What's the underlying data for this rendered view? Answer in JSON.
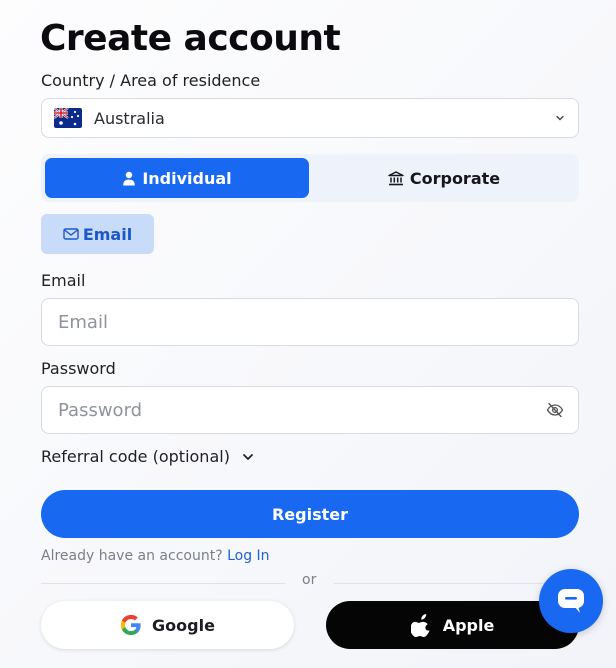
{
  "page": {
    "title": "Create account"
  },
  "country": {
    "label": "Country / Area of residence",
    "selected": "Australia",
    "flag_icon": "australia-flag-icon"
  },
  "account_type": {
    "individual": "Individual",
    "corporate": "Corporate",
    "active": "Individual"
  },
  "method_tab": {
    "label": "Email"
  },
  "email": {
    "label": "Email",
    "placeholder": "Email",
    "value": ""
  },
  "password": {
    "label": "Password",
    "placeholder": "Password",
    "value": ""
  },
  "referral": {
    "label": "Referral code (optional)"
  },
  "register": {
    "label": "Register"
  },
  "login": {
    "prompt": "Already have an account?",
    "link": "Log In"
  },
  "divider": {
    "text": "or"
  },
  "social": {
    "google": "Google",
    "apple": "Apple"
  },
  "colors": {
    "primary": "#1868f2",
    "tab_active_bg": "#c8dcfa",
    "segment_bg": "#edf2fb",
    "apple_bg": "#050505"
  },
  "icons": {
    "individual": "person-icon",
    "corporate": "bank-icon",
    "email": "envelope-icon",
    "password_toggle": "eye-off-icon",
    "google": "google-logo-icon",
    "apple": "apple-logo-icon",
    "chat": "chat-icon"
  }
}
